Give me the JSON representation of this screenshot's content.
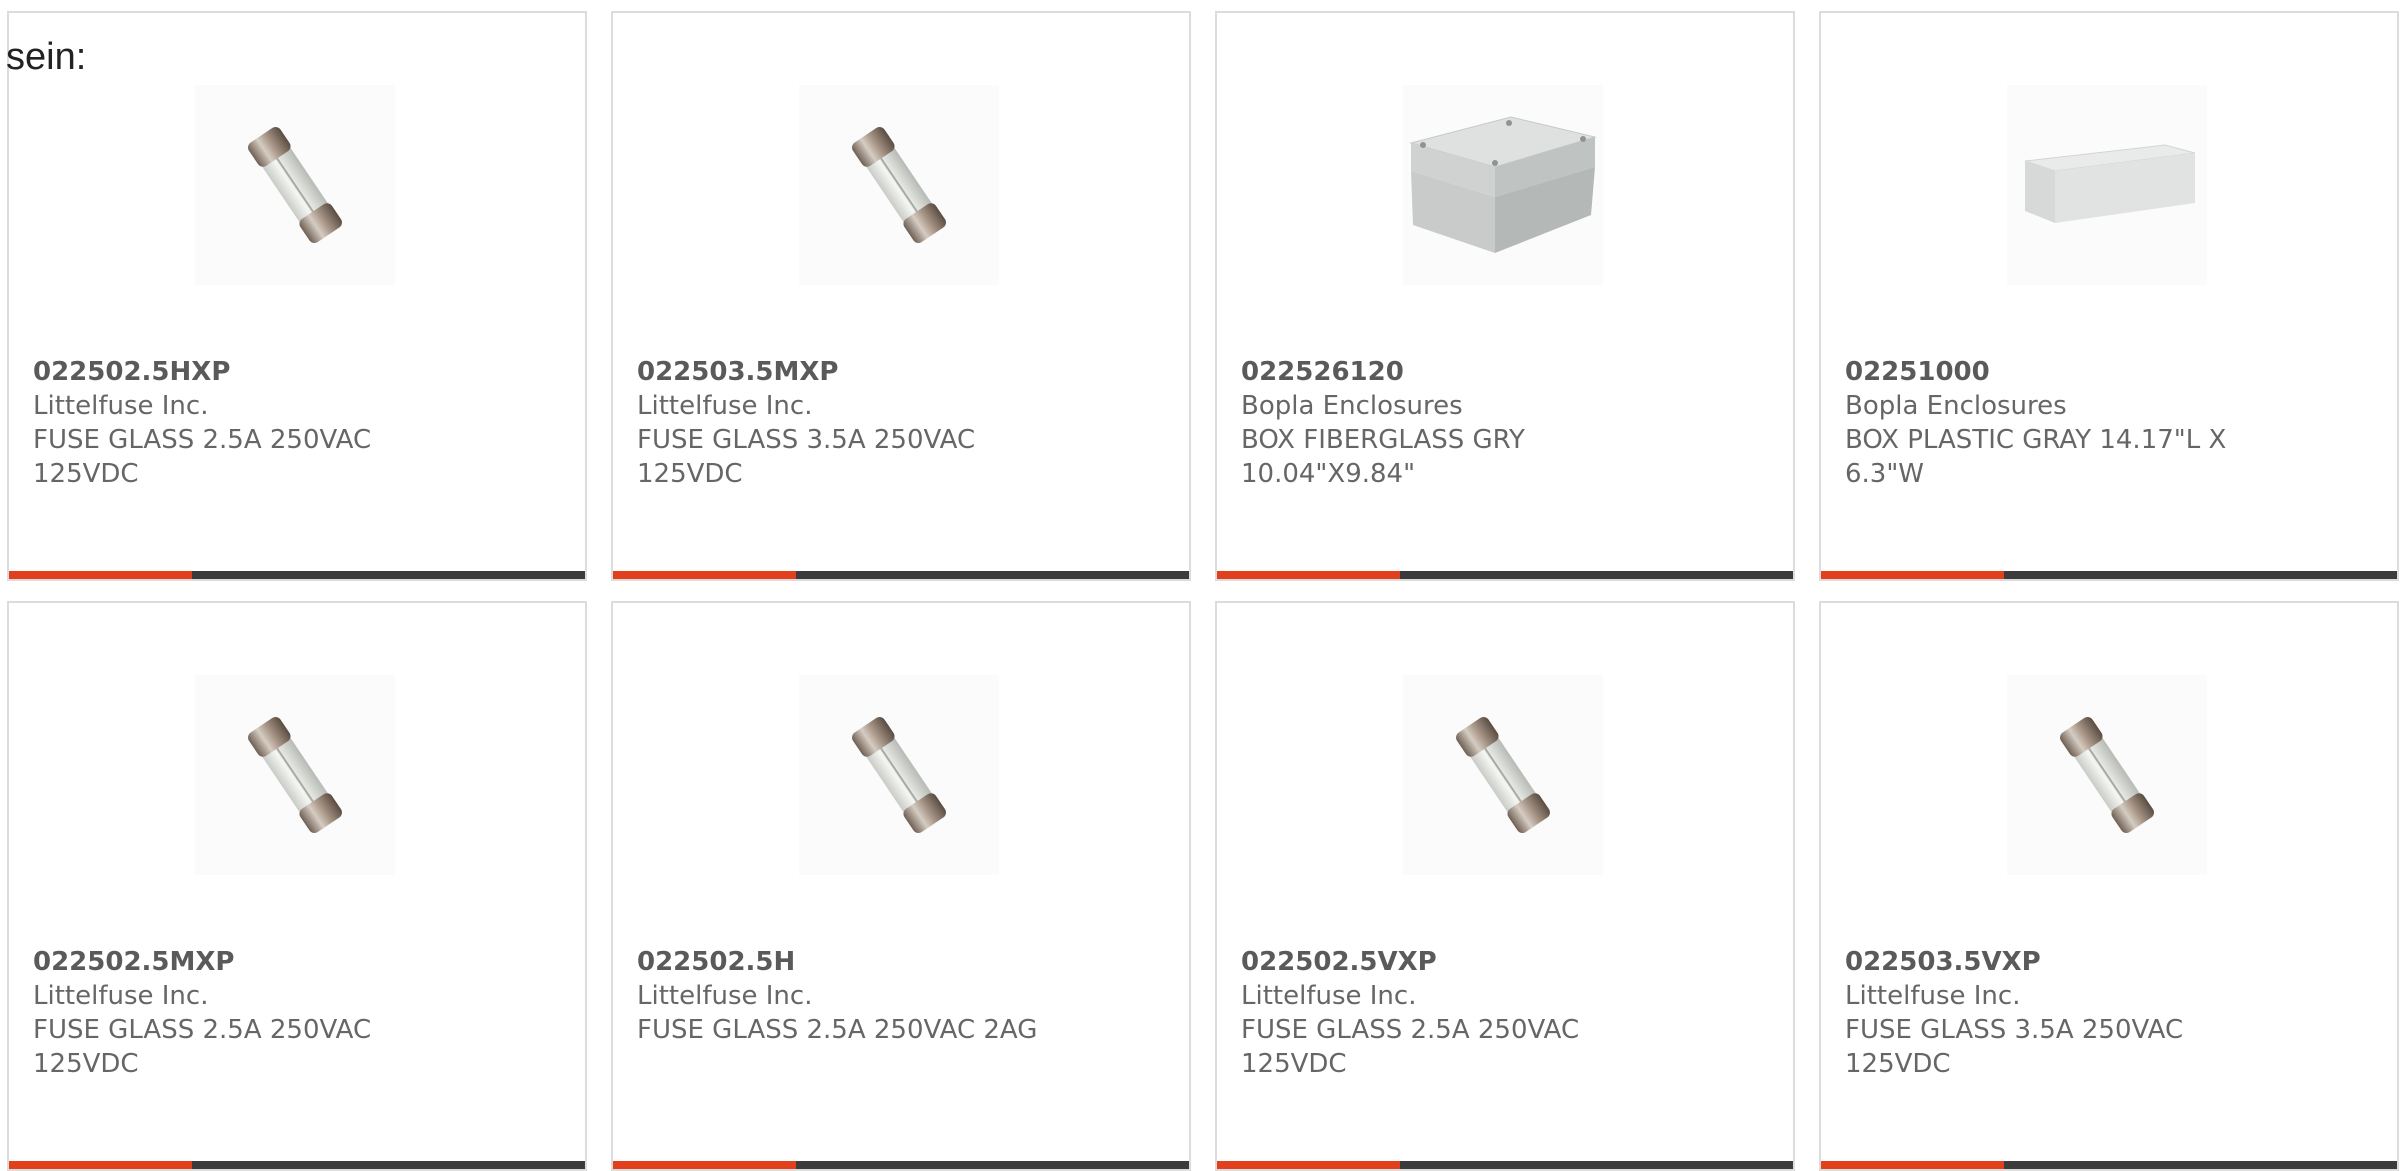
{
  "lead_text": "sein:",
  "colors": {
    "accent_bar": "#e2401c",
    "bar_track": "#3b3b3b",
    "card_border": "#dcdcdc",
    "text": "#666666"
  },
  "products": [
    {
      "part_number": "022502.5HXP",
      "manufacturer": "Littelfuse Inc.",
      "description": "FUSE GLASS 2.5A 250VAC 125VDC",
      "image": "glass-fuse-icon"
    },
    {
      "part_number": "022503.5MXP",
      "manufacturer": "Littelfuse Inc.",
      "description": "FUSE GLASS 3.5A 250VAC 125VDC",
      "image": "glass-fuse-icon"
    },
    {
      "part_number": "022526120",
      "manufacturer": "Bopla Enclosures",
      "description": "BOX FIBERGLASS GRY 10.04\"X9.84\"",
      "image": "enclosure-box-icon"
    },
    {
      "part_number": "02251000",
      "manufacturer": "Bopla Enclosures",
      "description": "BOX PLASTIC GRAY 14.17\"L X 6.3\"W",
      "image": "enclosure-flat-icon"
    },
    {
      "part_number": "022502.5MXP",
      "manufacturer": "Littelfuse Inc.",
      "description": "FUSE GLASS 2.5A 250VAC 125VDC",
      "image": "glass-fuse-icon"
    },
    {
      "part_number": "022502.5H",
      "manufacturer": "Littelfuse Inc.",
      "description": "FUSE GLASS 2.5A 250VAC 2AG",
      "image": "glass-fuse-icon"
    },
    {
      "part_number": "022502.5VXP",
      "manufacturer": "Littelfuse Inc.",
      "description": "FUSE GLASS 2.5A 250VAC 125VDC",
      "image": "glass-fuse-icon"
    },
    {
      "part_number": "022503.5VXP",
      "manufacturer": "Littelfuse Inc.",
      "description": "FUSE GLASS 3.5A 250VAC 125VDC",
      "image": "glass-fuse-icon"
    }
  ]
}
